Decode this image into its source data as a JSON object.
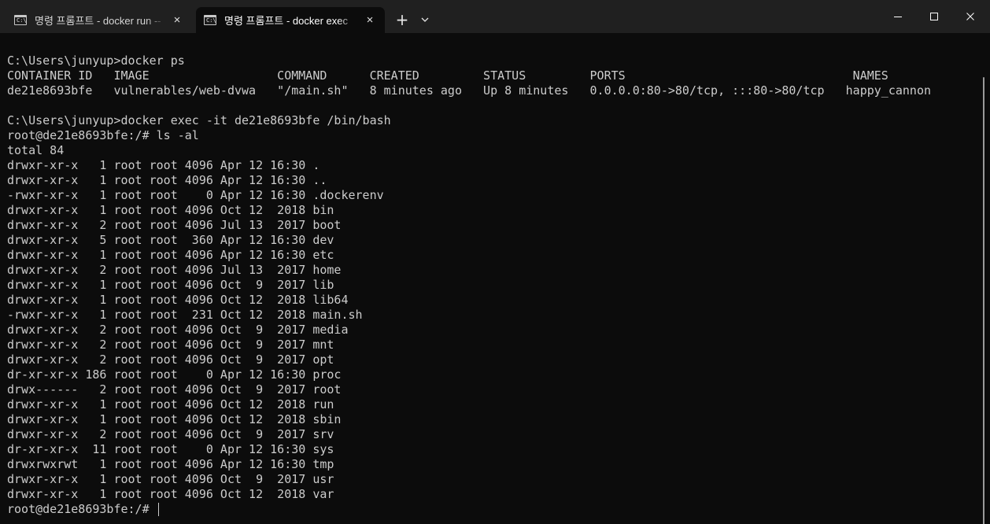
{
  "tabs": [
    {
      "title": "명령 프롬프트 - docker  run --",
      "icon": "cmd-prompt-icon",
      "active": false
    },
    {
      "title": "명령 프롬프트 - docker  exec",
      "icon": "cmd-prompt-icon",
      "active": true
    }
  ],
  "icons": {
    "tab_close": "×",
    "new_tab": "+",
    "cmd_glyph": "C:\\"
  },
  "terminal": {
    "lines": [
      "C:\\Users\\junyup>docker ps",
      "CONTAINER ID   IMAGE                  COMMAND      CREATED         STATUS         PORTS                                NAMES",
      "de21e8693bfe   vulnerables/web-dvwa   \"/main.sh\"   8 minutes ago   Up 8 minutes   0.0.0.0:80->80/tcp, :::80->80/tcp   happy_cannon",
      "",
      "C:\\Users\\junyup>docker exec -it de21e8693bfe /bin/bash",
      "root@de21e8693bfe:/# ls -al",
      "total 84",
      "drwxr-xr-x   1 root root 4096 Apr 12 16:30 .",
      "drwxr-xr-x   1 root root 4096 Apr 12 16:30 ..",
      "-rwxr-xr-x   1 root root    0 Apr 12 16:30 .dockerenv",
      "drwxr-xr-x   1 root root 4096 Oct 12  2018 bin",
      "drwxr-xr-x   2 root root 4096 Jul 13  2017 boot",
      "drwxr-xr-x   5 root root  360 Apr 12 16:30 dev",
      "drwxr-xr-x   1 root root 4096 Apr 12 16:30 etc",
      "drwxr-xr-x   2 root root 4096 Jul 13  2017 home",
      "drwxr-xr-x   1 root root 4096 Oct  9  2017 lib",
      "drwxr-xr-x   1 root root 4096 Oct 12  2018 lib64",
      "-rwxr-xr-x   1 root root  231 Oct 12  2018 main.sh",
      "drwxr-xr-x   2 root root 4096 Oct  9  2017 media",
      "drwxr-xr-x   2 root root 4096 Oct  9  2017 mnt",
      "drwxr-xr-x   2 root root 4096 Oct  9  2017 opt",
      "dr-xr-xr-x 186 root root    0 Apr 12 16:30 proc",
      "drwx------   2 root root 4096 Oct  9  2017 root",
      "drwxr-xr-x   1 root root 4096 Oct 12  2018 run",
      "drwxr-xr-x   1 root root 4096 Oct 12  2018 sbin",
      "drwxr-xr-x   2 root root 4096 Oct  9  2017 srv",
      "dr-xr-xr-x  11 root root    0 Apr 12 16:30 sys",
      "drwxrwxrwt   1 root root 4096 Apr 12 16:30 tmp",
      "drwxr-xr-x   1 root root 4096 Oct  9  2017 usr",
      "drwxr-xr-x   1 root root 4096 Oct 12  2018 var"
    ],
    "current_prompt": "root@de21e8693bfe:/# "
  },
  "colors": {
    "terminal_bg": "#0c0c0c",
    "terminal_fg": "#cccccc",
    "titlebar_bg": "#202020"
  }
}
